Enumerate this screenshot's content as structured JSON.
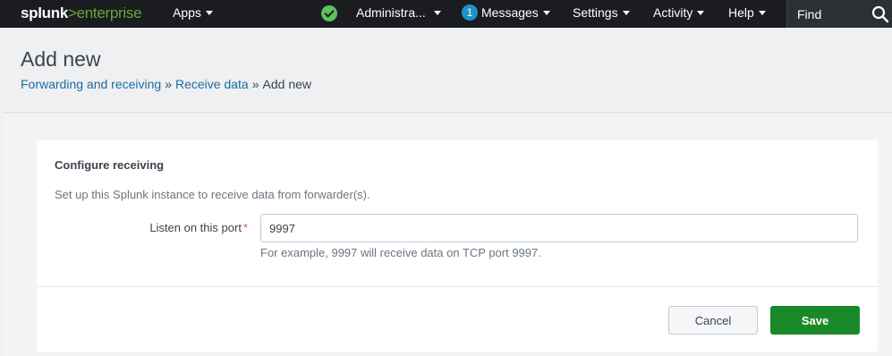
{
  "topbar": {
    "logo_main": "splunk",
    "logo_accent": ">enterprise",
    "apps_label": "Apps",
    "admin_label": "Administra...",
    "messages_count": "1",
    "messages_label": "Messages",
    "settings_label": "Settings",
    "activity_label": "Activity",
    "help_label": "Help",
    "find_placeholder": "Find"
  },
  "header": {
    "title": "Add new",
    "breadcrumb": [
      "Forwarding and receiving",
      "Receive data",
      "Add new"
    ],
    "separator": "»"
  },
  "form": {
    "section_title": "Configure receiving",
    "description": "Set up this Splunk instance to receive data from forwarder(s).",
    "port_label": "Listen on this port",
    "required_mark": "*",
    "port_value": "9997",
    "help_text": "For example, 9997 will receive data on TCP port 9997."
  },
  "buttons": {
    "cancel": "Cancel",
    "save": "Save"
  },
  "colors": {
    "topbar_bg": "#1a1c20",
    "brand_green": "#65a637",
    "save_green": "#1a8929",
    "link_blue": "#1e6d9f",
    "badge_blue": "#1e93c6"
  }
}
